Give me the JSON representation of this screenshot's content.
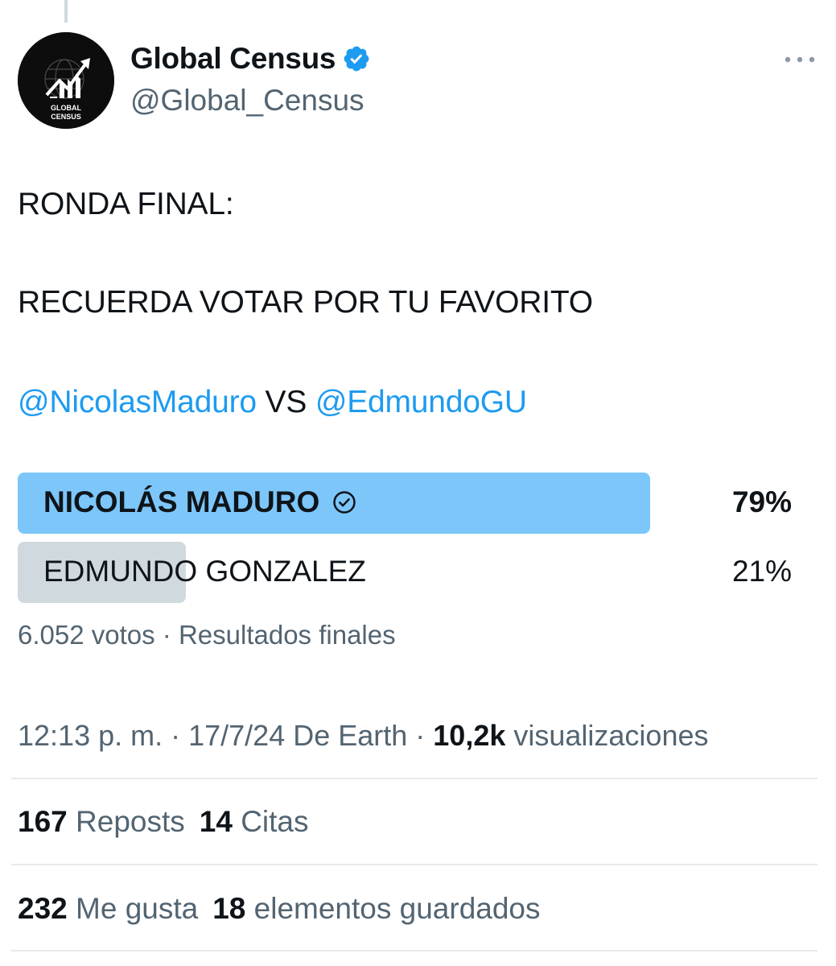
{
  "author": {
    "display_name": "Global Census",
    "handle": "@Global_Census",
    "avatar_text": [
      "GLOBAL",
      "CENSUS"
    ],
    "verified": true
  },
  "tweet": {
    "line1": "RONDA FINAL:",
    "line2": "RECUERDA VOTAR POR TU FAVORITO",
    "mention1": "@NicolasMaduro",
    "vs": " VS ",
    "mention2": "@EdmundoGU"
  },
  "poll": {
    "options": [
      {
        "label": "NICOLÁS MADURO",
        "percent": 79,
        "percent_label": "79%",
        "winner": true
      },
      {
        "label": "EDMUNDO GONZALEZ",
        "percent": 21,
        "percent_label": "21%",
        "winner": false
      }
    ],
    "meta": "6.052 votos · Resultados finales"
  },
  "timestamp": {
    "time": "12:13 p. m. · 17/7/24 De Earth · ",
    "views_count": "10,2k",
    "views_label": " visualizaciones"
  },
  "stats": {
    "reposts_count": "167",
    "reposts_label": "Reposts",
    "quotes_count": "14",
    "quotes_label": "Citas",
    "likes_count": "232",
    "likes_label": "Me gusta",
    "bookmarks_count": "18",
    "bookmarks_label": "elementos guardados"
  },
  "colors": {
    "accent": "#1d9bf0",
    "winner_bar": "#7cc6fa",
    "loser_bar": "#cfd9de",
    "secondary_text": "#536471"
  },
  "icons": [
    "verified-badge-icon",
    "more-options-icon",
    "check-circle-icon"
  ]
}
